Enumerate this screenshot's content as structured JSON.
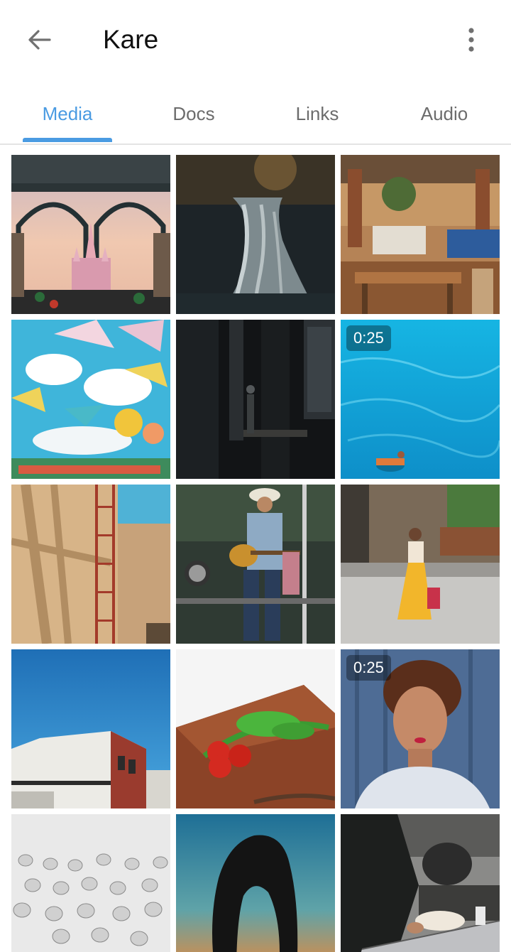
{
  "header": {
    "title": "Kare",
    "back_icon": "arrow-left-icon",
    "menu_icon": "more-vertical-icon"
  },
  "tabs": [
    {
      "label": "Media",
      "active": true
    },
    {
      "label": "Docs",
      "active": false
    },
    {
      "label": "Links",
      "active": false
    },
    {
      "label": "Audio",
      "active": false
    }
  ],
  "colors": {
    "accent": "#4a9be2",
    "tab_inactive": "#6c6c6c",
    "title": "#111111"
  },
  "media": [
    {
      "subject": "castle-through-arches",
      "duration": ""
    },
    {
      "subject": "waterfall",
      "duration": ""
    },
    {
      "subject": "restaurant-interior",
      "duration": ""
    },
    {
      "subject": "umbrellas-sky",
      "duration": ""
    },
    {
      "subject": "man-dark-building",
      "duration": ""
    },
    {
      "subject": "swimmer-turquoise-water",
      "duration": "0:25"
    },
    {
      "subject": "building-ladder-shadows",
      "duration": ""
    },
    {
      "subject": "guitarist-on-stage",
      "duration": ""
    },
    {
      "subject": "woman-yellow-dress-street",
      "duration": ""
    },
    {
      "subject": "white-house-blue-sky",
      "duration": ""
    },
    {
      "subject": "tomatoes-celery-board",
      "duration": ""
    },
    {
      "subject": "woman-portrait-blue-door",
      "duration": "0:25"
    },
    {
      "subject": "birds-in-snow",
      "duration": ""
    },
    {
      "subject": "rock-arch-sunset",
      "duration": ""
    },
    {
      "subject": "cooking-flatbread",
      "duration": ""
    }
  ]
}
